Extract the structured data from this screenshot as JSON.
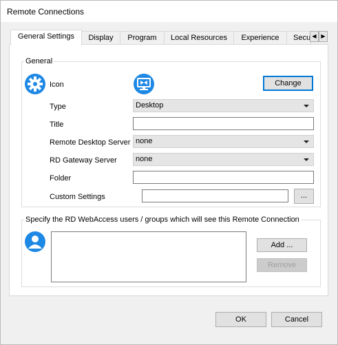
{
  "window": {
    "title": "Remote Connections"
  },
  "tabs": [
    {
      "label": "General Settings",
      "active": true
    },
    {
      "label": "Display"
    },
    {
      "label": "Program"
    },
    {
      "label": "Local Resources"
    },
    {
      "label": "Experience"
    },
    {
      "label": "Secu"
    }
  ],
  "tab_scroll": {
    "left": "◀",
    "right": "▶"
  },
  "general": {
    "legend": "General",
    "icon_label": "Icon",
    "change_button": "Change",
    "type_label": "Type",
    "type_value": "Desktop",
    "title_label": "Title",
    "title_value": "",
    "rds_label": "Remote Desktop Server",
    "rds_value": "none",
    "gateway_label": "RD Gateway Server",
    "gateway_value": "none",
    "folder_label": "Folder",
    "folder_value": "",
    "custom_label": "Custom Settings",
    "custom_value": "",
    "browse_button": "..."
  },
  "webaccess": {
    "legend": "Specify the RD WebAccess users / groups which will see this Remote Connection",
    "add_button": "Add ...",
    "remove_button": "Remove"
  },
  "footer": {
    "ok_button": "OK",
    "cancel_button": "Cancel"
  },
  "colors": {
    "accent": "#0078d7",
    "icon_blue": "#1e88e5"
  },
  "icons": [
    "settings-gear-icon",
    "remote-desktop-icon",
    "user-icon"
  ]
}
